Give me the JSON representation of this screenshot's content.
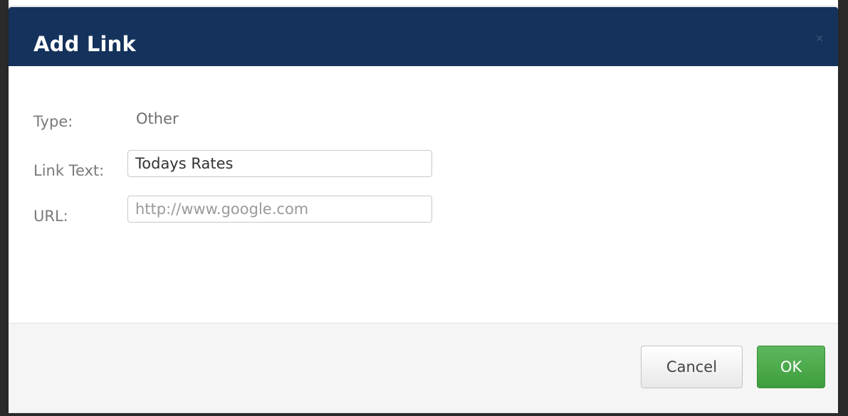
{
  "dialog": {
    "title": "Add Link",
    "close_icon": "close-icon",
    "type_label": "Type:",
    "type_value": "Other",
    "link_text_label": "Link Text:",
    "link_text_value": "Todays Rates",
    "url_label": "URL:",
    "url_value": "",
    "url_placeholder": "http://www.google.com",
    "cancel_label": "Cancel",
    "ok_label": "OK"
  },
  "colors": {
    "header": "#14325c",
    "ok_button": "#4cae4c",
    "footer": "#f5f5f5"
  }
}
